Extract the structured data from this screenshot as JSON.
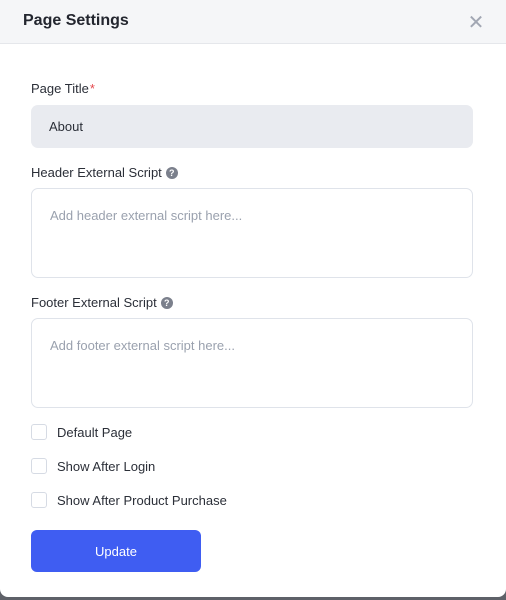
{
  "modal": {
    "title": "Page Settings",
    "close_icon": "close-icon"
  },
  "fields": {
    "page_title": {
      "label": "Page Title",
      "required_mark": "*",
      "value": "About"
    },
    "header_script": {
      "label": "Header External Script",
      "help_icon": "question-icon",
      "placeholder": "Add header external script here..."
    },
    "footer_script": {
      "label": "Footer External Script",
      "help_icon": "question-icon",
      "placeholder": "Add footer external script here..."
    }
  },
  "checkboxes": [
    {
      "label": "Default Page",
      "checked": false
    },
    {
      "label": "Show After Login",
      "checked": false
    },
    {
      "label": "Show After Product Purchase",
      "checked": false
    }
  ],
  "actions": {
    "update_label": "Update"
  },
  "colors": {
    "primary": "#3f5df2",
    "required": "#e5484d"
  }
}
